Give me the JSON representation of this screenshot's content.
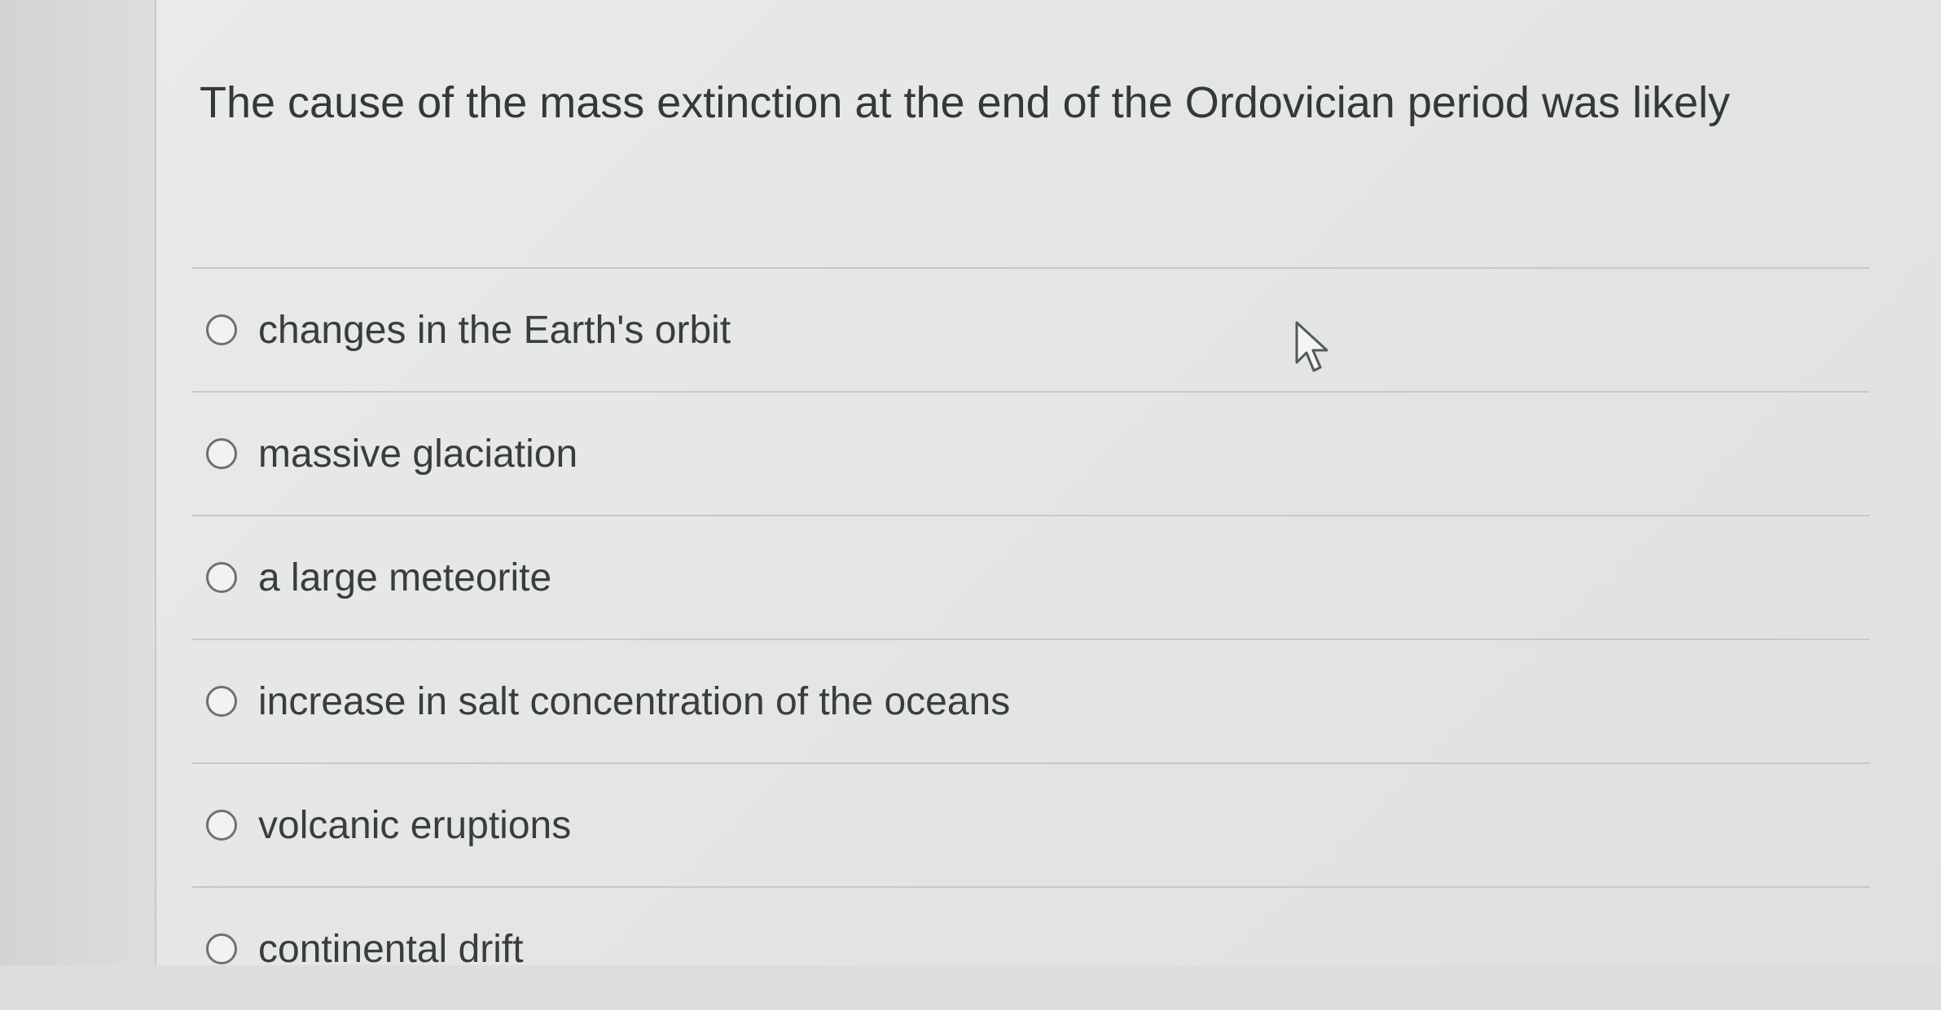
{
  "question": {
    "text": "The cause of the mass extinction at the end of the Ordovician period was likely"
  },
  "options": [
    {
      "label": "changes in the Earth's orbit",
      "selected": false
    },
    {
      "label": "massive glaciation",
      "selected": false
    },
    {
      "label": "a large meteorite",
      "selected": false
    },
    {
      "label": "increase in salt concentration of the oceans",
      "selected": false
    },
    {
      "label": "volcanic eruptions",
      "selected": false
    },
    {
      "label": "continental drift",
      "selected": false
    }
  ],
  "icons": {
    "radio": "radio-unchecked-icon",
    "cursor": "mouse-pointer-icon"
  },
  "colors": {
    "background": "#e6e8e7",
    "text": "#35383a",
    "divider": "#c6c9c8",
    "radio_border": "#6d7174"
  }
}
